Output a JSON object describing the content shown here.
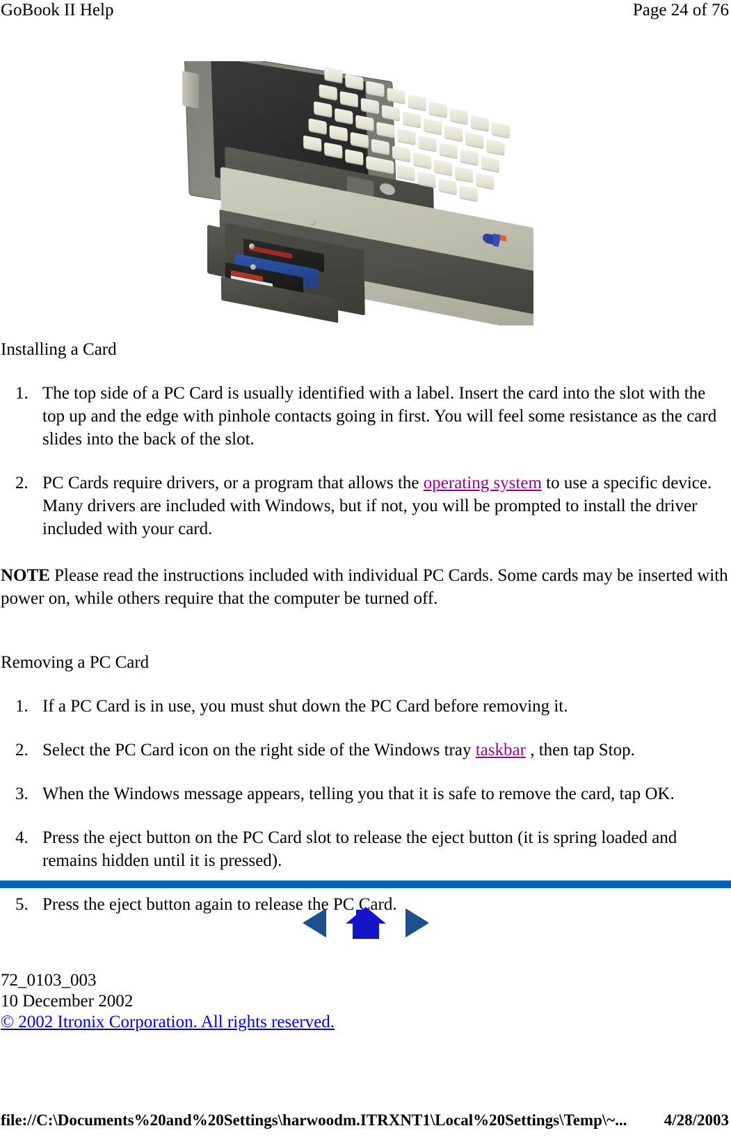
{
  "header": {
    "left": "GoBook II Help",
    "right": "Page 24 of 76"
  },
  "figure": {
    "alt": "Rugged GoBook II notebook computer with the PC Card slot door open and an IBM Microdrive PC Card partially inserted",
    "caption": ""
  },
  "sections": [
    {
      "heading": "Installing a Card",
      "items": [
        {
          "num": "1.",
          "parts": [
            {
              "type": "text",
              "value": "The top side of a PC Card is usually identified with a label. Insert the card into the slot with the top up and the edge with pinhole contacts going in first. You will feel some resistance as the card slides into the back of the slot."
            }
          ]
        },
        {
          "num": "2.",
          "parts": [
            {
              "type": "text",
              "value": "PC Cards require drivers, or a program that allows the "
            },
            {
              "type": "link",
              "value": "operating system",
              "style": "visited"
            },
            {
              "type": "text",
              "value": " to use a specific device. Many drivers are included with Windows, but if not, you will be prompted to install the driver included with your card."
            }
          ]
        }
      ]
    }
  ],
  "note": {
    "label": "NOTE",
    "text": "  Please read the instructions included with individual PC Cards. Some cards may be inserted with power on, while others require that the computer be turned off."
  },
  "section2": {
    "heading": "Removing a PC Card",
    "items": [
      {
        "num": "1.",
        "parts": [
          {
            "type": "text",
            "value": "If a PC Card is in use, you must shut down the PC Card before removing it."
          }
        ]
      },
      {
        "num": "2.",
        "parts": [
          {
            "type": "text",
            "value": "Select the PC Card icon on the right side of the Windows tray "
          },
          {
            "type": "link",
            "value": "taskbar",
            "style": "visited"
          },
          {
            "type": "text",
            "value": " , then tap Stop."
          }
        ]
      },
      {
        "num": "3.",
        "parts": [
          {
            "type": "text",
            "value": "When the Windows message appears, telling you that it is safe to remove the card, tap OK."
          }
        ]
      },
      {
        "num": "4.",
        "parts": [
          {
            "type": "text",
            "value": "Press the eject button on the PC Card slot to release the eject button (it is spring loaded and remains hidden until it is pressed)."
          }
        ]
      },
      {
        "num": "5.",
        "parts": [
          {
            "type": "text",
            "value": "Press the eject button again to release the PC Card."
          }
        ]
      }
    ]
  },
  "nav": {
    "back": "back-arrow-icon",
    "home": "home-icon",
    "forward": "forward-arrow-icon",
    "color": "#1414b4",
    "back_color": "#1c4f8c"
  },
  "doc_footer": {
    "doc_number": "72_0103_003",
    "date": "10 December 2002",
    "copyright": "© 2002 Itronix Corporation.  All rights reserved."
  },
  "path_footer": {
    "path": "file://C:\\Documents%20and%20Settings\\harwoodm.ITRXNT1\\Local%20Settings\\Temp\\~...",
    "date": "4/28/2003"
  },
  "colors": {
    "divider": "#0066b3",
    "visited_link": "#990099",
    "blue_link": "#0000EE"
  }
}
